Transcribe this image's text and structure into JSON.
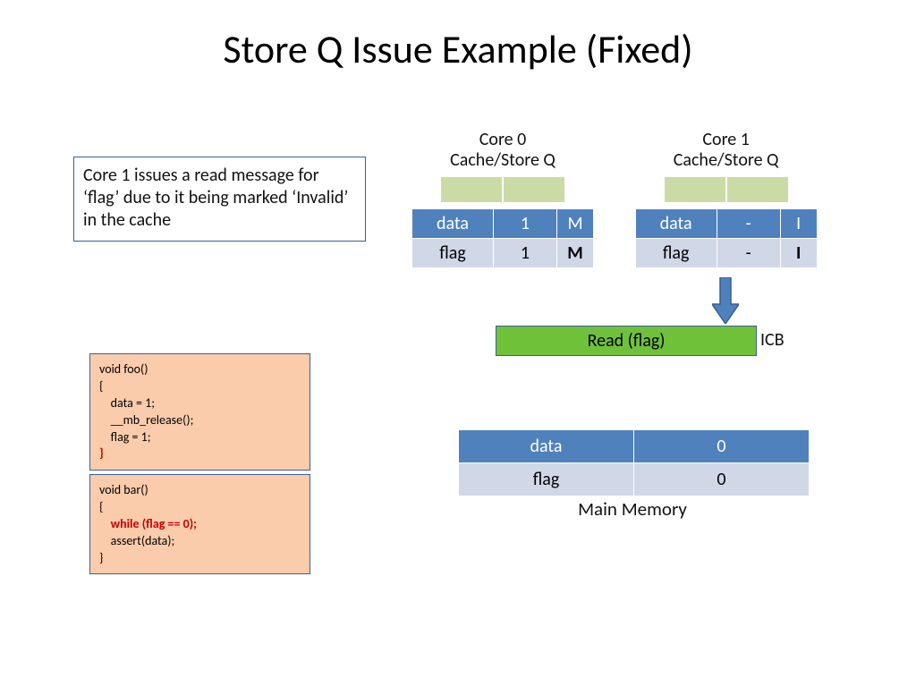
{
  "title": "Store Q Issue Example (Fixed)",
  "note": "Core 1 issues a read message for ‘flag’ due to it being marked ‘Invalid’ in the cache",
  "core0": {
    "label_line1": "Core 0",
    "label_line2": "Cache/Store Q",
    "cache": {
      "hdr_name": "data",
      "hdr_val": "1",
      "hdr_state": "M",
      "row_name": "flag",
      "row_val": "1",
      "row_state": "M"
    }
  },
  "core1": {
    "label_line1": "Core 1",
    "label_line2": "Cache/Store Q",
    "cache": {
      "hdr_name": "data",
      "hdr_val": "-",
      "hdr_state": "I",
      "row_name": "flag",
      "row_val": "-",
      "row_state": "I"
    }
  },
  "icb": {
    "text": "Read (flag)",
    "label": "ICB"
  },
  "memory": {
    "hdr_name": "data",
    "hdr_val": "0",
    "row_name": "flag",
    "row_val": "0",
    "label": "Main Memory"
  },
  "code_foo": {
    "l1": "void foo()",
    "l2": "{",
    "l3": "    data = 1;",
    "l4": "    __mb_release();",
    "l5": "    flag = 1;",
    "l6": "}"
  },
  "code_bar": {
    "l1": "void bar()",
    "l2": "{",
    "l3": "    while (flag == 0);",
    "l4": "    assert(data);",
    "l5": "}"
  }
}
